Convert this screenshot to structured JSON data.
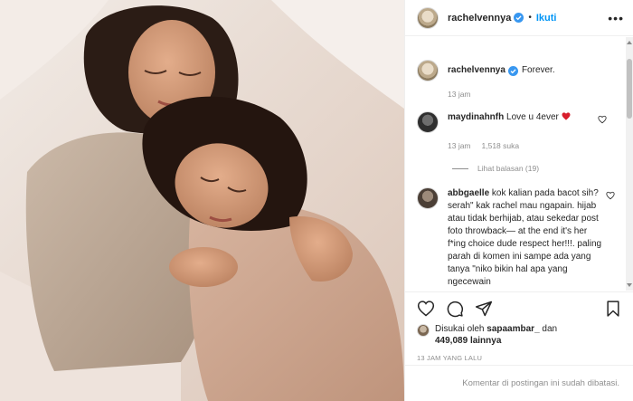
{
  "post": {
    "username": "rachelvennya",
    "follow_label": "Ikuti",
    "more_label": "•••",
    "separator": "•"
  },
  "caption": {
    "username": "rachelvennya",
    "text": "Forever.",
    "time": "13 jam"
  },
  "comments": [
    {
      "username": "maydinahnfh",
      "text": "Love u 4ever",
      "time": "13 jam",
      "likes": "1,518 suka",
      "replies_label": "Lihat balasan (19)"
    },
    {
      "username": "abbgaelle",
      "text": "kok kalian pada bacot sih? serah\" kak rachel mau ngapain. hijab atau tidak berhijab, atau sekedar post foto throwback— at the end it's her f*ing choice dude respect her!!!. paling parah di komen ini sampe ada yang tanya \"niko bikin hal apa yang ngecewain"
    }
  ],
  "likes": {
    "prefix": "Disukai oleh",
    "user": "sapaambar_",
    "middle": "dan",
    "count": "449,089",
    "suffix": "lainnya"
  },
  "timestamp": "13 JAM YANG LALU",
  "footer": "Komentar di postingan ini sudah dibatasi.",
  "colors": {
    "accent": "#0095f6",
    "verified": "#3897f0",
    "heart": "#ed4956",
    "text": "#262626",
    "muted": "#8e8e8e"
  },
  "icons": {
    "like": "heart-outline-icon",
    "comment": "comment-bubble-icon",
    "share": "paper-plane-icon",
    "save": "bookmark-icon"
  }
}
